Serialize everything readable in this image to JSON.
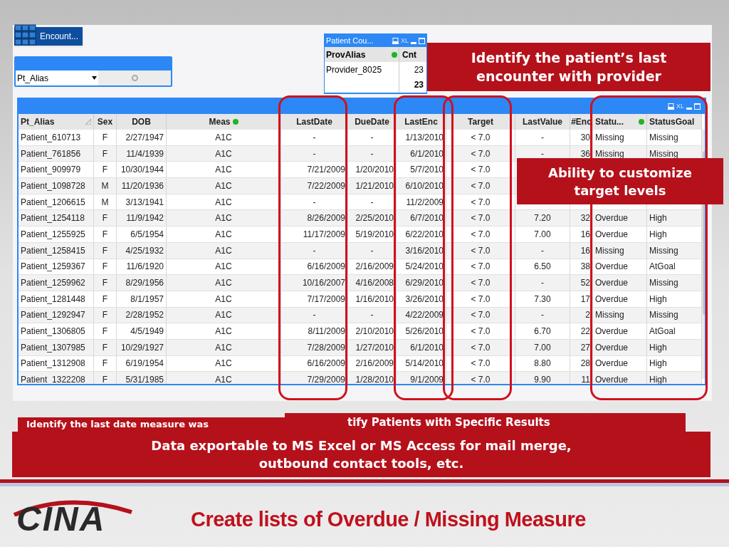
{
  "encounter_button": {
    "label": "Encount..."
  },
  "list_box": {
    "field": "Pt_Alias"
  },
  "patient_count": {
    "title": "Patient Cou...",
    "export_label": "XL",
    "columns": [
      "ProvAlias",
      "Cnt"
    ],
    "rows": [
      [
        "Provider_8025",
        "23"
      ]
    ],
    "total": "23"
  },
  "callout_top": {
    "text": "Identify the patient’s last encounter with provider"
  },
  "table": {
    "export_label": "XL",
    "columns": [
      "Pt_Alias",
      "Sex",
      "DOB",
      "Meas",
      "LastDate",
      "DueDate",
      "LastEnc",
      "Target",
      "LastValue",
      "#Enc",
      "Statu...",
      "StatusGoal"
    ],
    "rows": [
      [
        "Patient_610713",
        "F",
        "2/27/1947",
        "A1C",
        "-",
        "-",
        "1/13/2010",
        "< 7.0",
        "-",
        "30",
        "Missing",
        "Missing"
      ],
      [
        "Patient_761856",
        "F",
        "11/4/1939",
        "A1C",
        "-",
        "-",
        "6/1/2010",
        "< 7.0",
        "-",
        "36",
        "Missing",
        "Missing"
      ],
      [
        "Patient_909979",
        "F",
        "10/30/1944",
        "A1C",
        "7/21/2009",
        "1/20/2010",
        "5/7/2010",
        "< 7.0",
        null,
        null,
        null,
        null
      ],
      [
        "Patient_1098728",
        "M",
        "11/20/1936",
        "A1C",
        "7/22/2009",
        "1/21/2010",
        "6/10/2010",
        "< 7.0",
        null,
        null,
        null,
        null
      ],
      [
        "Patient_1206615",
        "M",
        "3/13/1941",
        "A1C",
        "-",
        "-",
        "11/2/2009",
        "< 7.0",
        null,
        null,
        null,
        null
      ],
      [
        "Patient_1254118",
        "F",
        "11/9/1942",
        "A1C",
        "8/26/2009",
        "2/25/2010",
        "6/7/2010",
        "< 7.0",
        "7.20",
        "32",
        "Overdue",
        "High"
      ],
      [
        "Patient_1255925",
        "F",
        "6/5/1954",
        "A1C",
        "11/17/2009",
        "5/19/2010",
        "6/22/2010",
        "< 7.0",
        "7.00",
        "16",
        "Overdue",
        "High"
      ],
      [
        "Patient_1258415",
        "F",
        "4/25/1932",
        "A1C",
        "-",
        "-",
        "3/16/2010",
        "< 7.0",
        "-",
        "16",
        "Missing",
        "Missing"
      ],
      [
        "Patient_1259367",
        "F",
        "11/6/1920",
        "A1C",
        "6/16/2009",
        "2/16/2009",
        "5/24/2010",
        "< 7.0",
        "6.50",
        "38",
        "Overdue",
        "AtGoal"
      ],
      [
        "Patient_1259962",
        "F",
        "8/29/1956",
        "A1C",
        "10/16/2007",
        "4/16/2008",
        "6/29/2010",
        "< 7.0",
        "-",
        "52",
        "Overdue",
        "Missing"
      ],
      [
        "Patient_1281448",
        "F",
        "8/1/1957",
        "A1C",
        "7/17/2009",
        "1/16/2010",
        "3/26/2010",
        "< 7.0",
        "7.30",
        "17",
        "Overdue",
        "High"
      ],
      [
        "Patient_1292947",
        "F",
        "2/28/1952",
        "A1C",
        "-",
        "-",
        "4/22/2009",
        "< 7.0",
        "-",
        "2",
        "Missing",
        "Missing"
      ],
      [
        "Patient_1306805",
        "F",
        "4/5/1949",
        "A1C",
        "8/11/2009",
        "2/10/2010",
        "5/26/2010",
        "< 7.0",
        "6.70",
        "22",
        "Overdue",
        "AtGoal"
      ],
      [
        "Patient_1307985",
        "F",
        "10/29/1927",
        "A1C",
        "7/28/2009",
        "1/27/2010",
        "6/1/2010",
        "< 7.0",
        "7.00",
        "27",
        "Overdue",
        "High"
      ],
      [
        "Patient_1312908",
        "F",
        "6/19/1954",
        "A1C",
        "6/16/2009",
        "2/16/2009",
        "5/14/2010",
        "< 7.0",
        "8.80",
        "28",
        "Overdue",
        "High"
      ],
      [
        "Patient_1322208",
        "F",
        "5/31/1985",
        "A1C",
        "7/29/2009",
        "1/28/2010",
        "9/1/2009",
        "< 7.0",
        "9.90",
        "11",
        "Overdue",
        "High"
      ]
    ]
  },
  "callout_target": {
    "text": "Ability to customize target levels"
  },
  "callouts_behind": [
    "Identify the last date measure was",
    "tify Patients with Specific Results"
  ],
  "callout_bottom": {
    "text": "Data exportable to MS Excel or MS Access for mail merge, outbound contact tools, etc."
  },
  "logo": {
    "text": "CINA"
  },
  "slide_title": "Create lists of Overdue / Missing Measure"
}
